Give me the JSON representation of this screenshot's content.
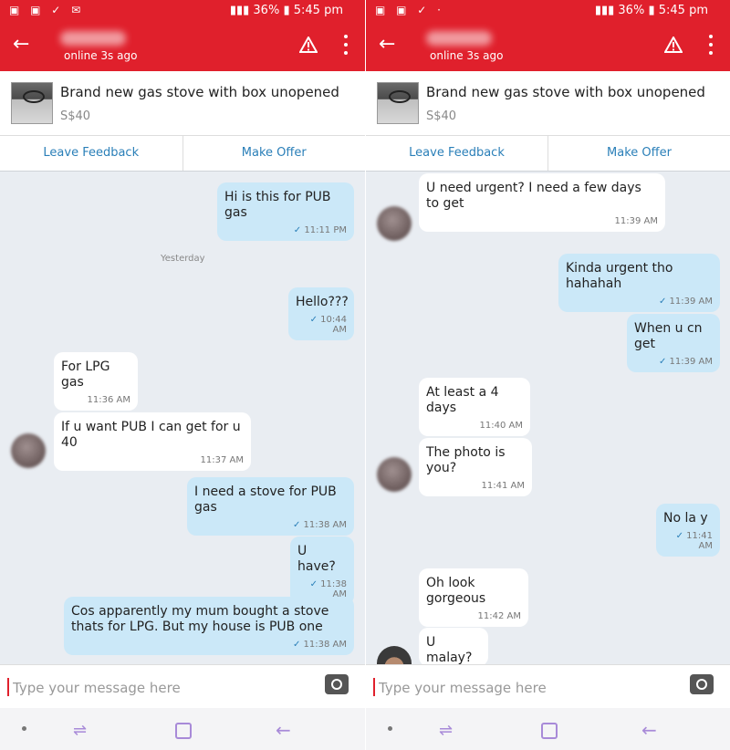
{
  "status": {
    "time": "5:45 pm",
    "battery": "36%",
    "left_icons_left": "▣ ▣ ✓ ✉",
    "left_icons_right": "▣ ▣ ✓ ·"
  },
  "header": {
    "online": "online 3s ago"
  },
  "product": {
    "title": "Brand new gas stove with box unopened",
    "price": "S$40"
  },
  "actions": {
    "leave_feedback": "Leave Feedback",
    "make_offer": "Make Offer"
  },
  "input": {
    "placeholder": "Type your message here"
  },
  "left_chat": {
    "date_label": "Yesterday",
    "messages": [
      {
        "side": "out",
        "text": "Hi is this for PUB gas",
        "time": "11:11 PM"
      },
      {
        "side": "out",
        "text": "Hello???",
        "time": "10:44 AM"
      },
      {
        "side": "in",
        "text": "For LPG gas",
        "time": "11:36 AM"
      },
      {
        "side": "in",
        "text": "If u want PUB I can get for u 40",
        "time": "11:37 AM"
      },
      {
        "side": "out",
        "text": "I need a stove for PUB gas",
        "time": "11:38 AM"
      },
      {
        "side": "out",
        "text": "U have?",
        "time": "11:38 AM"
      },
      {
        "side": "out",
        "text": "Cos apparently my mum bought a stove thats for LPG. But my house is PUB one",
        "time": "11:38 AM"
      }
    ]
  },
  "right_chat": {
    "messages": [
      {
        "side": "in",
        "text": "U need urgent? I need a few days to get",
        "time": "11:39 AM"
      },
      {
        "side": "out",
        "text": "Kinda urgent tho hahahah",
        "time": "11:39 AM"
      },
      {
        "side": "out",
        "text": "When u cn get",
        "time": "11:39 AM"
      },
      {
        "side": "in",
        "text": "At least a 4 days",
        "time": "11:40 AM"
      },
      {
        "side": "in",
        "text": "The photo is you?",
        "time": "11:41 AM"
      },
      {
        "side": "out",
        "text": "No la y",
        "time": "11:41 AM"
      },
      {
        "side": "in",
        "text": "Oh look gorgeous",
        "time": "11:42 AM"
      },
      {
        "side": "in",
        "text": "U malay?",
        "time": ""
      }
    ]
  },
  "colors": {
    "brand_red": "#e0202c",
    "outgoing_bubble": "#cbe8f8",
    "incoming_bubble": "#ffffff",
    "link_blue": "#2a7fb8"
  }
}
